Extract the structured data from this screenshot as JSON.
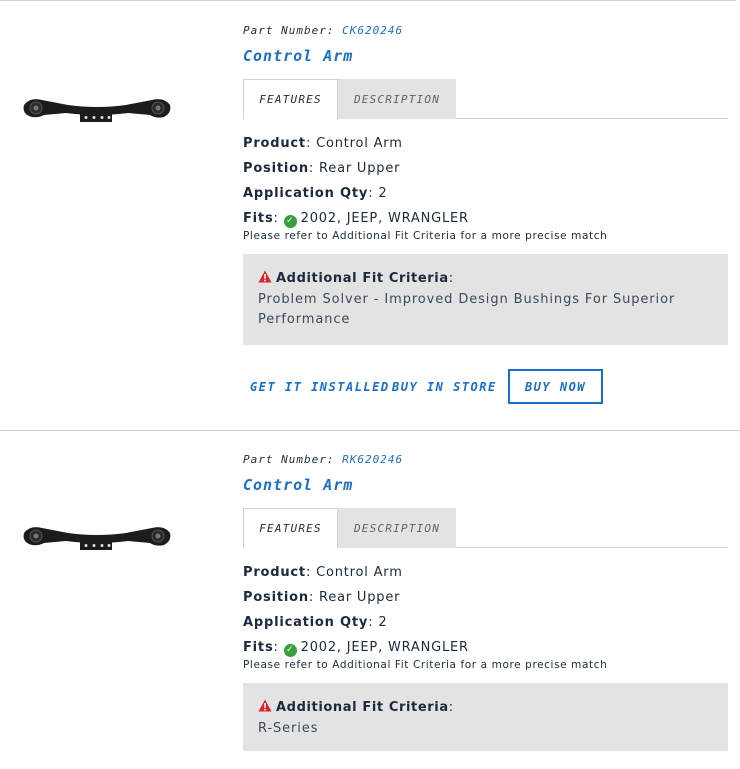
{
  "results": [
    {
      "part_number_label": "Part Number:",
      "part_number": "CK620246",
      "title": "Control Arm",
      "tabs": {
        "features": "FEATURES",
        "description": "DESCRIPTION"
      },
      "specs": {
        "product_label": "Product",
        "product_value": "Control Arm",
        "position_label": "Position",
        "position_value": "Rear Upper",
        "qty_label": "Application Qty",
        "qty_value": "2",
        "fits_label": "Fits",
        "fits_value": "2002, JEEP, WRANGLER"
      },
      "note": "Please refer to Additional Fit Criteria for a more precise match",
      "criteria_title": "Additional Fit Criteria",
      "criteria_text": "Problem Solver - Improved Design Bushings For Superior Performance",
      "actions": {
        "install": "GET IT INSTALLED",
        "store": "BUY IN STORE",
        "buy": "BUY NOW"
      }
    },
    {
      "part_number_label": "Part Number:",
      "part_number": "RK620246",
      "title": "Control Arm",
      "tabs": {
        "features": "FEATURES",
        "description": "DESCRIPTION"
      },
      "specs": {
        "product_label": "Product",
        "product_value": "Control Arm",
        "position_label": "Position",
        "position_value": "Rear Upper",
        "qty_label": "Application Qty",
        "qty_value": "2",
        "fits_label": "Fits",
        "fits_value": "2002, JEEP, WRANGLER"
      },
      "note": "Please refer to Additional Fit Criteria for a more precise match",
      "criteria_title": "Additional Fit Criteria",
      "criteria_text": "R-Series"
    }
  ],
  "colors": {
    "accent": "#1a70c9",
    "text": "#1b2a3c",
    "panel": "#e3e3e3",
    "fit_ok": "#36a13c",
    "warning": "#d7262e"
  },
  "icons": {
    "fits": "check-circle-icon",
    "criteria": "warning-triangle-icon"
  }
}
